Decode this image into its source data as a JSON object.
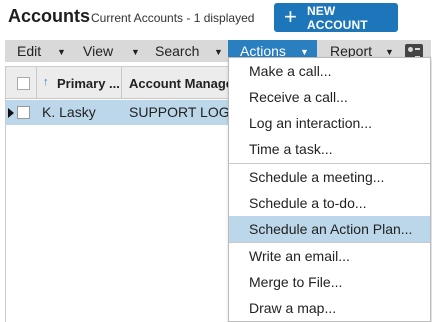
{
  "header": {
    "title": "Accounts",
    "subtitle": "Current Accounts - 1 displayed",
    "new_button": "NEW ACCOUNT",
    "new_button_icon": "plus-icon"
  },
  "menubar": {
    "items": [
      {
        "label": "Edit"
      },
      {
        "label": "View"
      },
      {
        "label": "Search"
      },
      {
        "label": "Actions"
      },
      {
        "label": "Report"
      }
    ],
    "active": "Actions",
    "right_icon": "contact-card-icon"
  },
  "grid": {
    "columns": [
      "Primary ...",
      "Account Manage"
    ],
    "sort_indicator": "ascending",
    "rows": [
      {
        "primary": "K. Lasky",
        "account_manager": "SUPPORT LOGIN"
      }
    ]
  },
  "actions_menu": {
    "items": [
      {
        "label": "Make a call..."
      },
      {
        "label": "Receive a call..."
      },
      {
        "label": "Log an interaction..."
      },
      {
        "label": "Time a task..."
      },
      {
        "label": "Schedule a meeting..."
      },
      {
        "label": "Schedule a to-do..."
      },
      {
        "label": "Schedule an Action Plan..."
      },
      {
        "label": "Write an email..."
      },
      {
        "label": "Merge to File..."
      },
      {
        "label": "Draw a map..."
      }
    ],
    "highlighted": "Schedule an Action Plan..."
  },
  "colors": {
    "accent": "#1d76b9",
    "menubar": "#d9d9d9",
    "selection": "#bcd7e9"
  }
}
